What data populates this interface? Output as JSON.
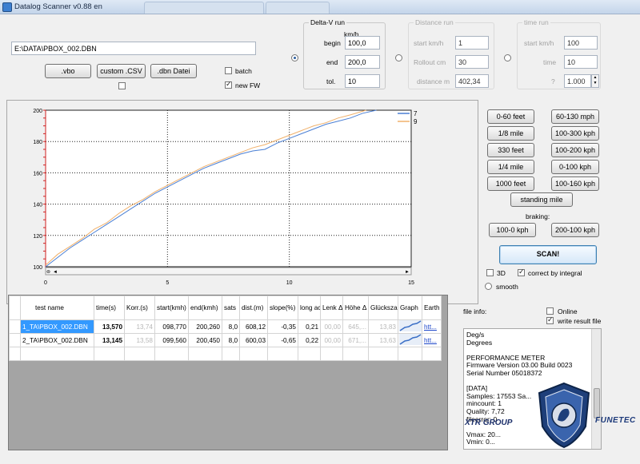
{
  "window": {
    "title": "Datalog Scanner v0.88 en"
  },
  "file_path": "E:\\DATA\\PBOX_002.DBN",
  "buttons": {
    "vbo": ".vbo",
    "custom_csv": "custom .CSV",
    "dbn": ".dbn Datei"
  },
  "checks": {
    "batch": "batch",
    "new_fw": "new FW",
    "three_d": "3D",
    "integral": "correct by integral",
    "smooth": "smooth",
    "online": "Online",
    "write_result": "write result file"
  },
  "delta_v": {
    "title": "Delta-V run",
    "unit": "km/h",
    "begin_label": "begin",
    "begin": "100,0",
    "end_label": "end",
    "end": "200,0",
    "tol_label": "tol.",
    "tol": "10"
  },
  "distance_run": {
    "title": "Distance run",
    "start_label": "start km/h",
    "start": "1",
    "rollout_label": "Rollout cm",
    "rollout": "30",
    "distance_label": "distance m",
    "distance": "402,34"
  },
  "time_run": {
    "title": "time run",
    "start_label": "start km/h",
    "start": "100",
    "time_label": "time",
    "time": "10",
    "q_label": "?",
    "spinner": "1.000"
  },
  "presets": {
    "left": [
      "0-60 feet",
      "1/8 mile",
      "330 feet",
      "1/4 mile",
      "1000 feet"
    ],
    "right": [
      "60-130 mph",
      "100-300 kph",
      "100-200 kph",
      "0-100 kph",
      "100-160 kph"
    ],
    "standing": "standing mile",
    "braking_label": "braking:",
    "braking": [
      "100-0 kph",
      "200-100 kph"
    ],
    "scan": "SCAN!"
  },
  "table": {
    "headers": [
      "test name",
      "time(s)",
      "Korr.(s)",
      "start(kmh)",
      "end(kmh)",
      "sats",
      "dist.(m)",
      "slope(%)",
      "long acc.(g",
      "Lenk Δ",
      "Höhe Δ abs",
      "Glücksza",
      "Graph",
      "Earth"
    ],
    "rows": [
      [
        "1_TA\\PBOX_002.DBN",
        "13,570",
        "13,74",
        "098,770",
        "200,260",
        "8,0",
        "608,12",
        "-0,35",
        "0,21",
        "00,00",
        "645,...",
        "13,83",
        "",
        "htt..."
      ],
      [
        "2_TA\\PBOX_002.DBN",
        "13,145",
        "13,58",
        "099,560",
        "200,450",
        "8,0",
        "600,03",
        "-0,65",
        "0,22",
        "00,00",
        "671,...",
        "13,63",
        "",
        "htt..."
      ]
    ]
  },
  "fileinfo": {
    "label": "file info:",
    "lines": [
      "Deg/s",
      "Degrees",
      "",
      "PERFORMANCE METER",
      "Firmware Version 03.00 Build 0023",
      "Serial Number 05018372",
      "",
      "[DATA]",
      "Samples: 17553   Sa...",
      "mincount: 1",
      "Quality: 7,72",
      "fileerror: 0",
      "",
      "Vmax: 20...",
      "Vmin: 0..."
    ]
  },
  "logos": {
    "xtr": "XTR GROUP",
    "funetec": "FUNETEC"
  },
  "chart_data": {
    "type": "line",
    "xlim": [
      0,
      15
    ],
    "ylim": [
      100,
      200
    ],
    "x_ticks": [
      0,
      5,
      10,
      15
    ],
    "y_ticks": [
      100,
      120,
      140,
      160,
      180,
      200
    ],
    "legend_position": "top-right",
    "series": [
      {
        "name": "7",
        "color": "#4a7fd4",
        "x": [
          0,
          0.5,
          1,
          1.5,
          2,
          2.5,
          3,
          3.5,
          4,
          4.5,
          5,
          5.5,
          6,
          6.5,
          7,
          7.5,
          8,
          8.5,
          9,
          9.5,
          10,
          10.5,
          11,
          11.5,
          12,
          12.5,
          13,
          13.57
        ],
        "y": [
          100,
          106,
          112,
          117,
          122,
          127,
          132,
          137,
          142,
          147,
          151,
          155,
          159,
          163,
          166,
          169,
          172,
          174,
          175,
          179,
          182,
          185,
          188,
          191,
          193,
          195,
          198,
          200
        ]
      },
      {
        "name": "9",
        "color": "#f0b06a",
        "x": [
          0,
          0.5,
          1,
          1.5,
          2,
          2.5,
          3,
          3.5,
          4,
          4.5,
          5,
          5.5,
          6,
          6.5,
          7,
          7.5,
          8,
          8.5,
          9,
          9.5,
          10,
          10.5,
          11,
          11.5,
          12,
          12.5,
          13.15
        ],
        "y": [
          101,
          108,
          113,
          118,
          124,
          128,
          134,
          139,
          143,
          148,
          152,
          156,
          160,
          164,
          167,
          170,
          173,
          176,
          178,
          181,
          184,
          187,
          190,
          192,
          195,
          197,
          200
        ]
      }
    ]
  }
}
